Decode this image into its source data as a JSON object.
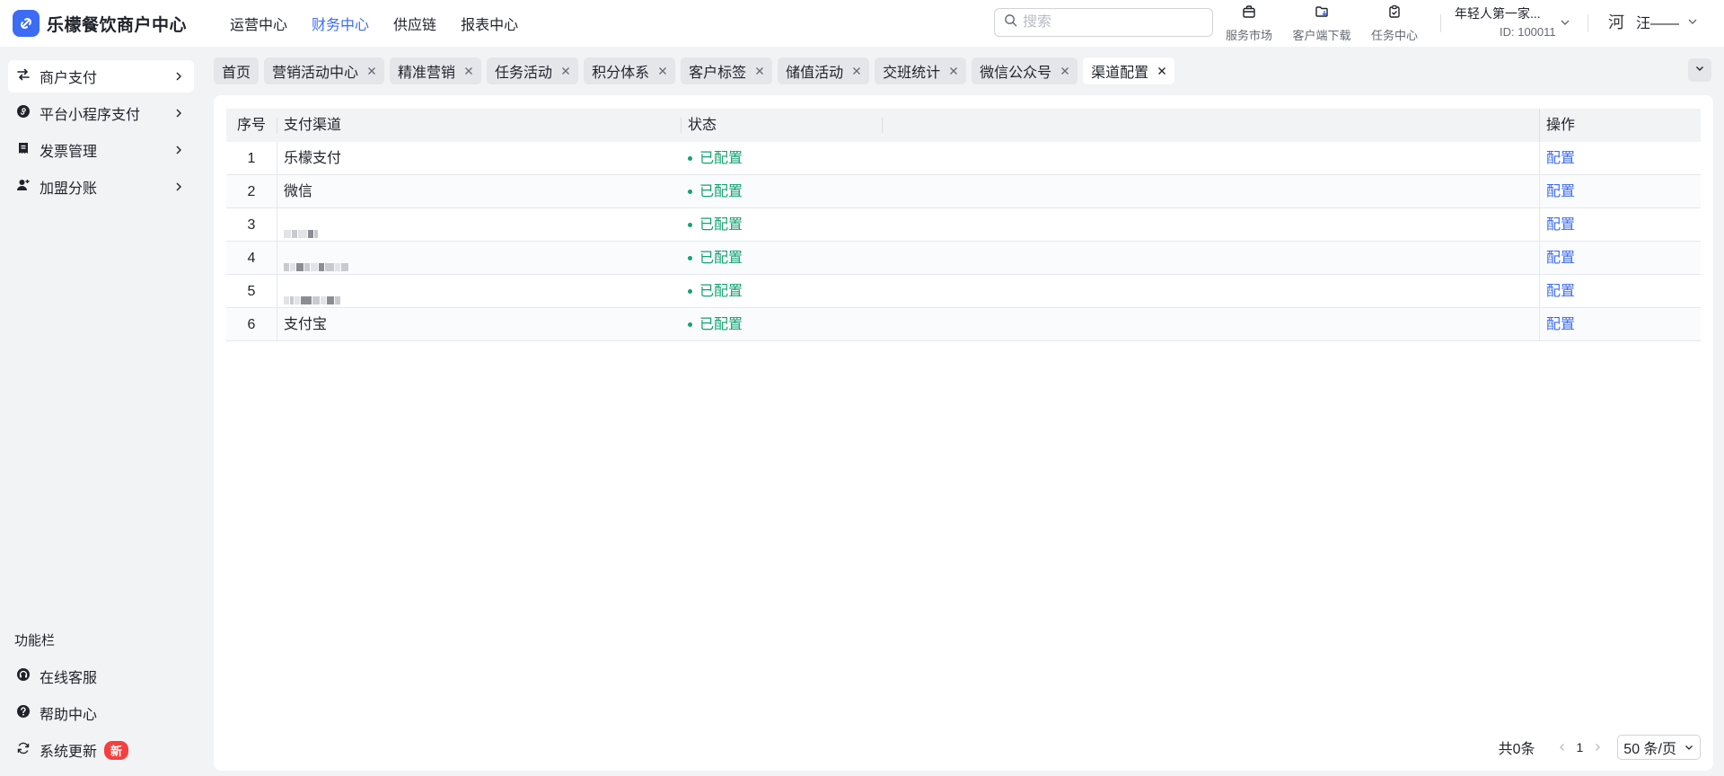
{
  "app": {
    "title": "乐檬餐饮商户中心",
    "top_nav": [
      {
        "label": "运营中心",
        "active": false
      },
      {
        "label": "财务中心",
        "active": true
      },
      {
        "label": "供应链",
        "active": false
      },
      {
        "label": "报表中心",
        "active": false
      }
    ],
    "search_placeholder": "搜索",
    "tools": [
      {
        "label": "服务市场",
        "icon": "bag-icon"
      },
      {
        "label": "客户端下载",
        "icon": "download-folder-icon"
      },
      {
        "label": "任务中心",
        "icon": "clipboard-check-icon"
      }
    ],
    "store": {
      "name": "年轻人第一家...",
      "id": "ID: 100011"
    },
    "user": {
      "avatar_text": "河",
      "name": "汪——"
    }
  },
  "sidebar": {
    "items": [
      {
        "label": "商户支付",
        "icon": "transfer-icon",
        "active": true
      },
      {
        "label": "平台小程序支付",
        "icon": "mini-program-icon",
        "active": false
      },
      {
        "label": "发票管理",
        "icon": "invoice-icon",
        "active": false
      },
      {
        "label": "加盟分账",
        "icon": "user-add-icon",
        "active": false
      }
    ],
    "section_title": "功能栏",
    "footer_items": [
      {
        "label": "在线客服",
        "icon": "headset-icon"
      },
      {
        "label": "帮助中心",
        "icon": "help-icon"
      },
      {
        "label": "系统更新",
        "icon": "refresh-icon",
        "badge": "新"
      }
    ]
  },
  "tabs": [
    {
      "label": "首页",
      "closable": false,
      "active": false
    },
    {
      "label": "营销活动中心",
      "closable": true,
      "active": false
    },
    {
      "label": "精准营销",
      "closable": true,
      "active": false
    },
    {
      "label": "任务活动",
      "closable": true,
      "active": false
    },
    {
      "label": "积分体系",
      "closable": true,
      "active": false
    },
    {
      "label": "客户标签",
      "closable": true,
      "active": false
    },
    {
      "label": "储值活动",
      "closable": true,
      "active": false
    },
    {
      "label": "交班统计",
      "closable": true,
      "active": false
    },
    {
      "label": "微信公众号",
      "closable": true,
      "active": false
    },
    {
      "label": "渠道配置",
      "closable": true,
      "active": true
    }
  ],
  "table": {
    "headers": {
      "index": "序号",
      "channel": "支付渠道",
      "status": "状态",
      "action": "操作"
    },
    "rows": [
      {
        "index": "1",
        "channel": "乐檬支付",
        "status": "已配置",
        "action": "配置"
      },
      {
        "index": "2",
        "channel": "微信",
        "status": "已配置",
        "action": "配置"
      },
      {
        "index": "3",
        "channel": "",
        "status": "已配置",
        "action": "配置"
      },
      {
        "index": "4",
        "channel": "",
        "status": "已配置",
        "action": "配置"
      },
      {
        "index": "5",
        "channel": "",
        "status": "已配置",
        "action": "配置"
      },
      {
        "index": "6",
        "channel": "支付宝",
        "status": "已配置",
        "action": "配置"
      }
    ]
  },
  "pagination": {
    "total": "共0条",
    "page": "1",
    "page_size": "50 条/页"
  },
  "colors": {
    "accent": "#3c6cf5",
    "success": "#13a36e",
    "badge": "#f53f3f"
  }
}
